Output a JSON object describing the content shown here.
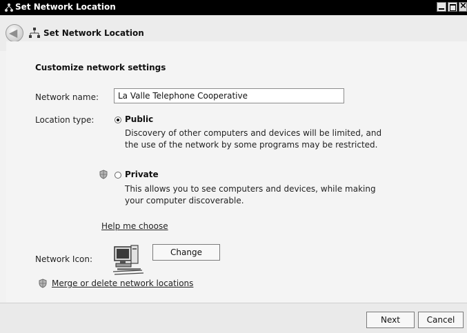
{
  "window": {
    "title": "Set Network Location"
  },
  "navbar": {
    "title": "Set Network Location"
  },
  "main": {
    "heading": "Customize network settings",
    "network_name": {
      "label": "Network name:",
      "value": "La Valle Telephone Cooperative"
    },
    "location_type": {
      "label": "Location type:",
      "options": [
        {
          "title": "Public",
          "selected": true,
          "desc_line1": "Discovery of other computers and devices will be limited, and",
          "desc_line2": "the use of the network by some programs may be restricted."
        },
        {
          "title": "Private",
          "selected": false,
          "desc_line1": "This allows you to see computers and devices, while making",
          "desc_line2": "your computer discoverable."
        }
      ]
    },
    "help_link": "Help me choose",
    "network_icon": {
      "label": "Network Icon:",
      "change_label": "Change"
    },
    "merge_link": "Merge or delete network locations"
  },
  "footer": {
    "next_label": "Next",
    "cancel_label": "Cancel"
  }
}
